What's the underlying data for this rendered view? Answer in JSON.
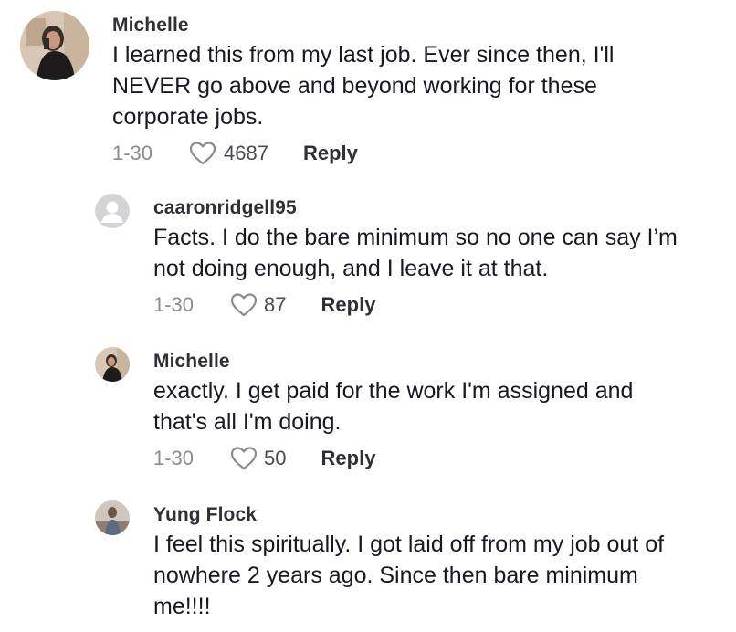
{
  "comments": [
    {
      "username": "Michelle",
      "lines": [
        "I learned this from my last job. Ever since then, I'll",
        "NEVER go above and beyond working for these",
        "corporate jobs."
      ],
      "date": "1-30",
      "likes": "4687",
      "reply_label": "Reply",
      "avatar": "user-photo"
    },
    {
      "username": "caaronridgell95",
      "lines": [
        "Facts. I do the bare minimum so no one can say I’m",
        "not doing enough, and I leave it at that."
      ],
      "date": "1-30",
      "likes": "87",
      "reply_label": "Reply",
      "avatar": "default-avatar"
    },
    {
      "username": "Michelle",
      "lines": [
        "exactly. I get paid for the work I'm assigned and",
        "that's all I'm doing."
      ],
      "date": "1-30",
      "likes": "50",
      "reply_label": "Reply",
      "avatar": "user-photo"
    },
    {
      "username": "Yung Flock",
      "lines": [
        "I feel this spiritually. I got laid off from my job out of",
        "nowhere 2 years ago. Since then bare minimum",
        "me!!!!"
      ],
      "avatar": "user-photo"
    }
  ],
  "icons": {
    "like": "heart-outline-icon"
  },
  "colors": {
    "text": "#161823",
    "muted": "#8a8b91",
    "username": "#2f3036"
  }
}
